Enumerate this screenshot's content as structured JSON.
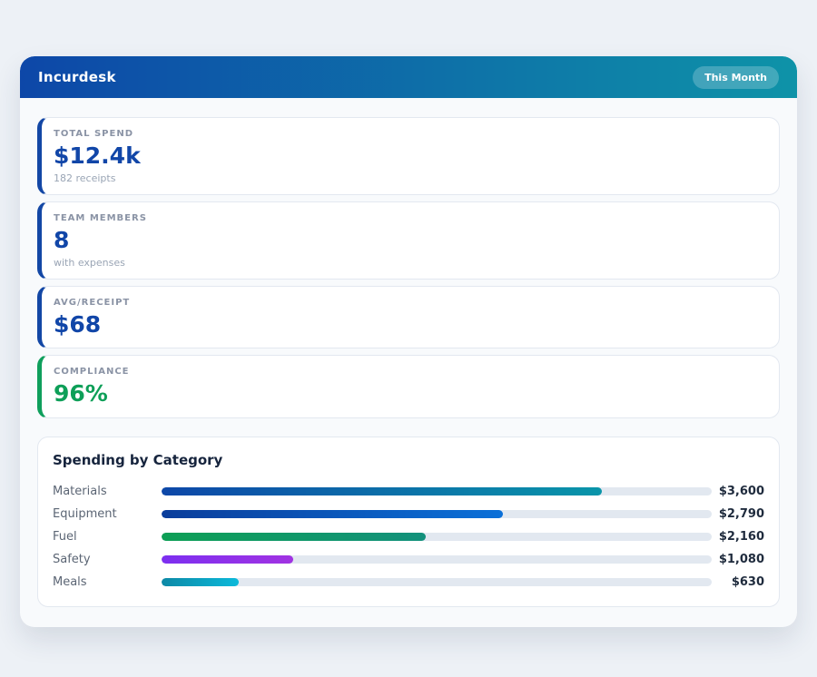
{
  "header": {
    "app_name": "Incurdesk",
    "period_badge": "This Month"
  },
  "stats": [
    {
      "label": "TOTAL SPEND",
      "value": "$12.4k",
      "sub": "182 receipts",
      "accent_color": "#1347a5",
      "value_color": "#1146a8"
    },
    {
      "label": "TEAM MEMBERS",
      "value": "8",
      "sub": "with expenses",
      "accent_color": "#1347a5",
      "value_color": "#1146a8"
    },
    {
      "label": "AVG/RECEIPT",
      "value": "$68",
      "sub": "",
      "accent_color": "#1347a5",
      "value_color": "#1146a8"
    },
    {
      "label": "COMPLIANCE",
      "value": "96%",
      "sub": "",
      "accent_color": "#0f9f5c",
      "value_color": "#0e9f58"
    }
  ],
  "chart": {
    "title": "Spending by Category"
  },
  "chart_data": {
    "type": "bar",
    "orientation": "horizontal",
    "title": "Spending by Category",
    "categories": [
      "Materials",
      "Equipment",
      "Fuel",
      "Safety",
      "Meals"
    ],
    "values": [
      3600,
      2790,
      2160,
      1080,
      630
    ],
    "value_labels": [
      "$3,600",
      "$2,790",
      "$2,160",
      "$1,080",
      "$630"
    ],
    "xlim": [
      0,
      4500
    ],
    "grid": false,
    "legend": false,
    "track_color": "#e2e8f0",
    "bar_gradients": [
      [
        "#0d47a8",
        "#0a95a9"
      ],
      [
        "#0a3d9b",
        "#0b70d8"
      ],
      [
        "#0d9f55",
        "#13917c"
      ],
      [
        "#7c2ff0",
        "#a133e2"
      ],
      [
        "#0d89a6",
        "#0cb9da"
      ]
    ]
  },
  "colors": {
    "page_bg": "#edf1f6",
    "panel_bg": "#f8fafc",
    "header_gradient_start": "#0d47a8",
    "header_gradient_end": "#0e93a8",
    "accent_blue": "#1347a5",
    "accent_green": "#0f9f5c"
  }
}
